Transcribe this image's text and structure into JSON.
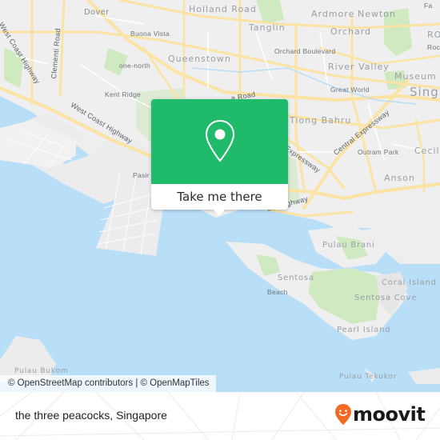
{
  "map": {
    "labels": {
      "dover": "Dover",
      "holland_road": "Holland Road",
      "ardmore": "Ardmore",
      "newton": "Newton",
      "tanglin": "Tanglin",
      "orchard": "Orchard",
      "orchard_boulevard": "Orchard Boulevard",
      "buona_vista": "Buona Vista",
      "one_north": "one-north",
      "queenstown": "Queenstown",
      "kent_ridge": "Kent Ridge",
      "river_valley": "River Valley",
      "great_world": "Great World",
      "museum": "Museum",
      "singapore": "Singa",
      "tiong_bahru": "Tiong Bahru",
      "outram_park": "Outram Park",
      "cecil": "Cecil",
      "anson": "Anson",
      "west_coast_highway_1": "West Coast Highway",
      "west_coast_highway_2": "West Coast Highway",
      "clementi_road": "Clementi Road",
      "central_expressway": "Central Expressway",
      "expressway": "Expressway",
      "coast_highway": "ast Highway",
      "road_fragment": "a Road",
      "pasir": "Pasir",
      "pulau_brani": "Pulau Brani",
      "sentosa": "Sentosa",
      "beach": "Beach",
      "coral_island": "Coral Island",
      "sentosa_cove": "Sentosa Cove",
      "pearl_island": "Pearl Island",
      "pulau_bukom": "Pulau Bukom",
      "pulau_tekukor": "Pulau Tekukor",
      "fan_fragment": "Fa",
      "roc_fragment": "ROC",
      "roc_small_fragment": "Roc"
    },
    "popup": {
      "icon": "map-pin-icon",
      "button_label": "Take me there",
      "accent_color": "#1fba6a"
    },
    "attribution": "© OpenStreetMap contributors | © OpenMapTiles"
  },
  "footer": {
    "place_name": "the three peacocks, Singapore",
    "brand": "moovit",
    "brand_color": "#f26a24"
  }
}
